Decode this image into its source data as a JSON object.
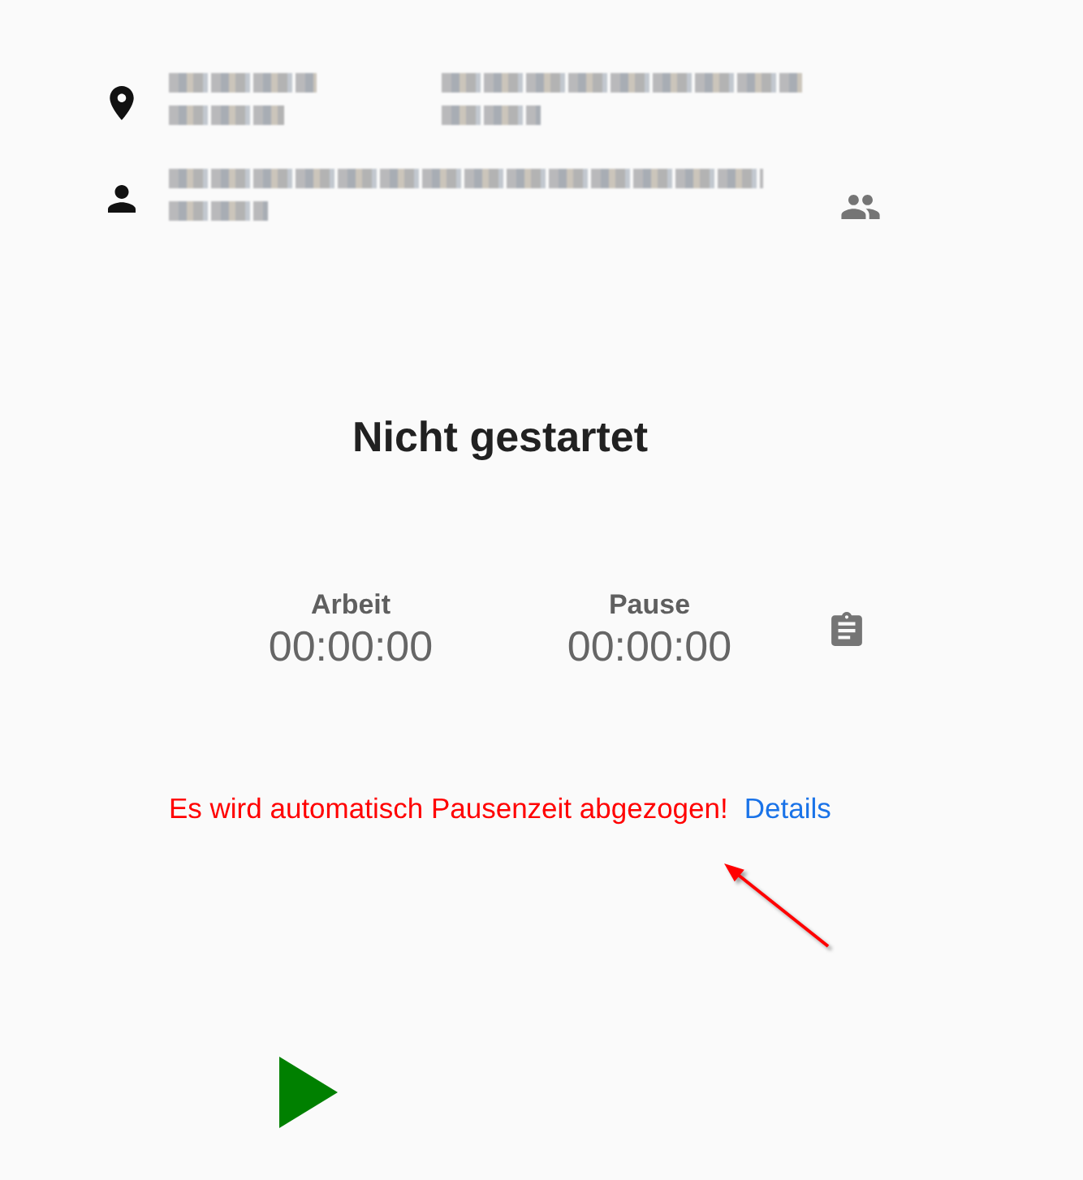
{
  "status": {
    "title": "Nicht gestartet"
  },
  "timers": [
    {
      "label": "Arbeit",
      "value": "00:00:00"
    },
    {
      "label": "Pause",
      "value": "00:00:00"
    }
  ],
  "notice": {
    "text": "Es wird automatisch Pausenzeit abgezogen!",
    "link": "Details"
  }
}
